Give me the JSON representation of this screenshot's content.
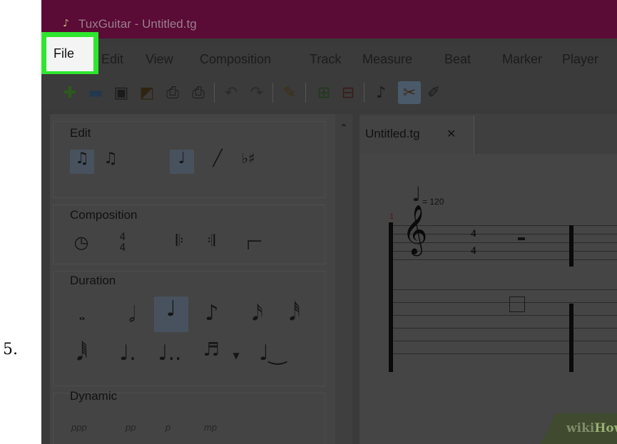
{
  "step_number": "5.",
  "window": {
    "title": "TuxGuitar - Untitled.tg",
    "app_icon": "tuxguitar-icon"
  },
  "menubar": {
    "items": [
      "File",
      "Edit",
      "View",
      "Composition",
      "Track",
      "Measure",
      "Beat",
      "Marker",
      "Player"
    ]
  },
  "highlight_color": "#2ee62e",
  "titlebar_color": "#5a0b36",
  "toolbar": {
    "icons": [
      "new-file-icon",
      "open-file-icon",
      "save-icon",
      "save-as-icon",
      "print-icon",
      "print-preview-icon",
      "undo-icon",
      "redo-icon",
      "edit-mode-icon",
      "add-track-icon",
      "remove-track-icon",
      "note-icon",
      "settings-icon"
    ]
  },
  "tool_panel": {
    "sections": [
      {
        "title": "Edit"
      },
      {
        "title": "Composition"
      },
      {
        "title": "Duration"
      },
      {
        "title": "Dynamic",
        "items": [
          "ppp",
          "pp",
          "p",
          "mp"
        ]
      }
    ]
  },
  "document": {
    "tab_label": "Untitled.tg",
    "tempo": "= 120",
    "measure_number": "1",
    "time_signature": {
      "top": "4",
      "bottom": "4"
    }
  },
  "watermark": {
    "wiki": "wiki",
    "how": "How"
  }
}
